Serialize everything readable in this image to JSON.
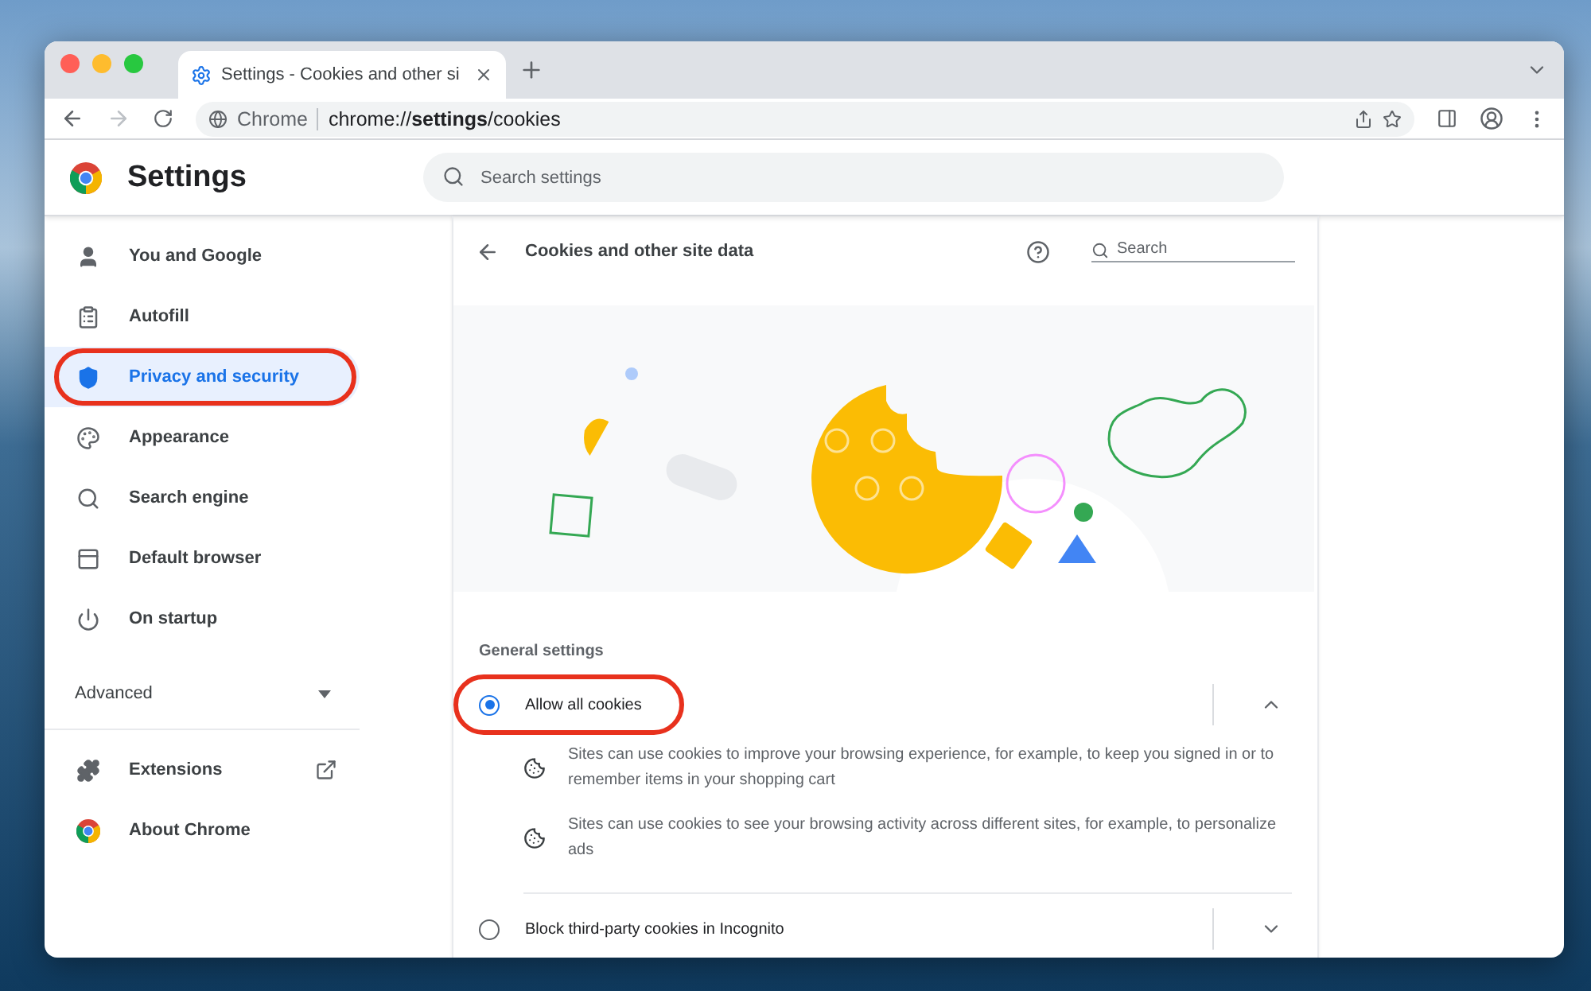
{
  "browser": {
    "tab": {
      "title": "Settings - Cookies and other si",
      "selected": true
    },
    "omnibox": {
      "chip": "Chrome",
      "url": "chrome://**settings**/cookies"
    }
  },
  "header": {
    "title": "Settings",
    "search": {
      "placeholder": "Search settings"
    }
  },
  "sidebar": {
    "items": [
      {
        "label": "You and Google",
        "selected": false,
        "highlighted": false
      },
      {
        "label": "Autofill",
        "selected": false,
        "highlighted": false
      },
      {
        "label": "Privacy and security",
        "selected": true,
        "highlighted": true
      },
      {
        "label": "Appearance",
        "selected": false,
        "highlighted": false
      },
      {
        "label": "Search engine",
        "selected": false,
        "highlighted": false
      },
      {
        "label": "Default browser",
        "selected": false,
        "highlighted": false
      },
      {
        "label": "On startup",
        "selected": false,
        "highlighted": false
      }
    ],
    "advanced": {
      "label": "Advanced",
      "expanded": false
    },
    "bottom_items": [
      {
        "label": "Extensions",
        "external": true
      },
      {
        "label": "About Chrome",
        "external": false
      }
    ]
  },
  "page": {
    "title": "Cookies and other site data",
    "search": {
      "placeholder": "Search"
    },
    "section_title": "General settings",
    "options": [
      {
        "label": "Allow all cookies",
        "selected": true,
        "expanded": true,
        "highlighted": true,
        "details": [
          "Sites can use cookies to improve your browsing experience, for example, to keep you signed in or to remember items in your shopping cart",
          "Sites can use cookies to see your browsing activity across different sites, for example, to personalize ads"
        ]
      },
      {
        "label": "Block third-party cookies in Incognito",
        "selected": false,
        "expanded": false,
        "highlighted": false
      }
    ]
  }
}
